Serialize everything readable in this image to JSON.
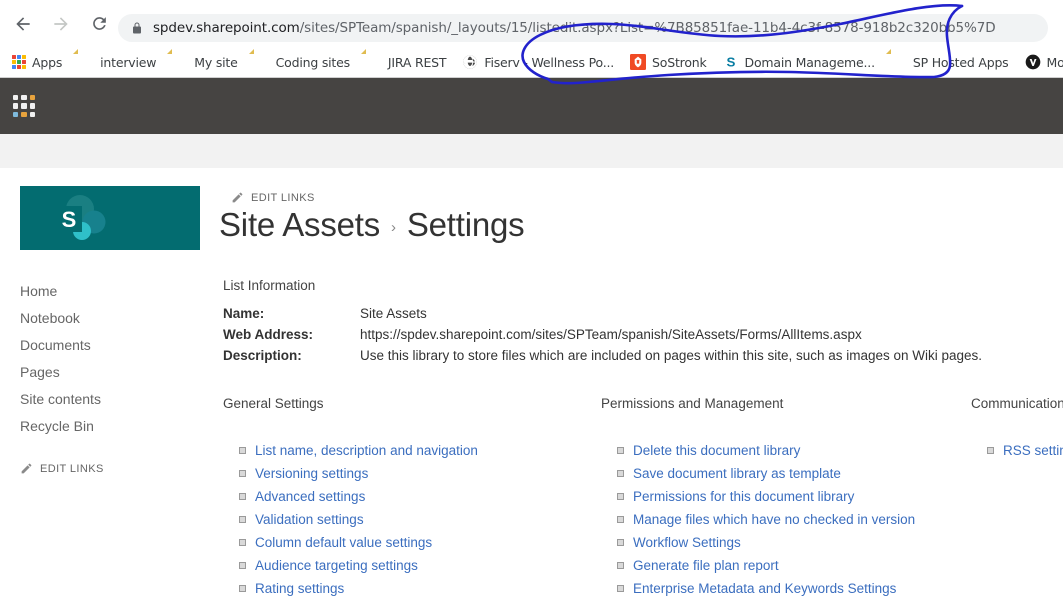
{
  "browser": {
    "back_label": "Back",
    "forward_label": "Forward",
    "reload_label": "Reload",
    "lock_icon": "lock-icon",
    "url_host": "spdev.sharepoint.com",
    "url_path": "/sites/SPTeam/spanish/_layouts/15/listedit.aspx?List=%7B85851fae-11b4-4c3f-8578-918b2c320bb5%7D",
    "url_full": "spdev.sharepoint.com/sites/SPTeam/spanish/_layouts/15/listedit.aspx?List=%7B85851fae-11b4-4c3f-8578-918b2c320bb5%7D",
    "bookmarks": [
      {
        "label": "Apps",
        "icon": "apps-grid-icon"
      },
      {
        "label": "interview",
        "icon": "folder-icon"
      },
      {
        "label": "My site",
        "icon": "folder-icon"
      },
      {
        "label": "Coding sites",
        "icon": "folder-icon"
      },
      {
        "label": "JIRA REST",
        "icon": "folder-icon"
      },
      {
        "label": "Fiserv - Wellness Po...",
        "icon": "globe-icon"
      },
      {
        "label": "SoStronk",
        "icon": "sostronk-icon"
      },
      {
        "label": "Domain Manageme...",
        "icon": "letter-s-icon"
      },
      {
        "label": "SP Hosted Apps",
        "icon": "folder-icon"
      },
      {
        "label": "Movies Torrent",
        "icon": "circle-v-icon"
      }
    ]
  },
  "suite_bar": {
    "waffle_icon": "app-launcher-waffle-icon",
    "background": "#464442"
  },
  "site": {
    "logo_icon": "sharepoint-logo-icon",
    "logo_background": "#036c70",
    "edit_links_top": "EDIT LINKS",
    "edit_links_icon": "pencil-icon",
    "breadcrumb_parent": "Site Assets",
    "breadcrumb_separator": "›",
    "breadcrumb_current": "Settings"
  },
  "left_nav": {
    "items": [
      {
        "label": "Home"
      },
      {
        "label": "Notebook"
      },
      {
        "label": "Documents"
      },
      {
        "label": "Pages"
      },
      {
        "label": "Site contents"
      },
      {
        "label": "Recycle Bin"
      }
    ],
    "edit_links_label": "EDIT LINKS",
    "edit_links_icon": "pencil-icon"
  },
  "list_information": {
    "heading": "List Information",
    "rows": [
      {
        "key": "Name:",
        "value": "Site Assets"
      },
      {
        "key": "Web Address:",
        "value": "https://spdev.sharepoint.com/sites/SPTeam/spanish/SiteAssets/Forms/AllItems.aspx"
      },
      {
        "key": "Description:",
        "value": "Use this library to store files which are included on pages within this site, such as images on Wiki pages."
      }
    ]
  },
  "settings_columns": [
    {
      "heading": "General Settings",
      "links": [
        "List name, description and navigation",
        "Versioning settings",
        "Advanced settings",
        "Validation settings",
        "Column default value settings",
        "Audience targeting settings",
        "Rating settings"
      ]
    },
    {
      "heading": "Permissions and Management",
      "links": [
        "Delete this document library",
        "Save document library as template",
        "Permissions for this document library",
        "Manage files which have no checked in version",
        "Workflow Settings",
        "Generate file plan report",
        "Enterprise Metadata and Keywords Settings"
      ]
    },
    {
      "heading": "Communications",
      "links": [
        "RSS settings"
      ]
    }
  ],
  "annotation": {
    "type": "hand-drawn-ink-circle",
    "color": "#2222cc",
    "describes": "circled list GUID query string in the address bar"
  },
  "colors": {
    "link": "#3b6ebf",
    "sharepoint_teal": "#036c70",
    "suite_bar": "#464442",
    "gray_band": "#f2f2f2",
    "ink_blue": "#2222cc"
  }
}
